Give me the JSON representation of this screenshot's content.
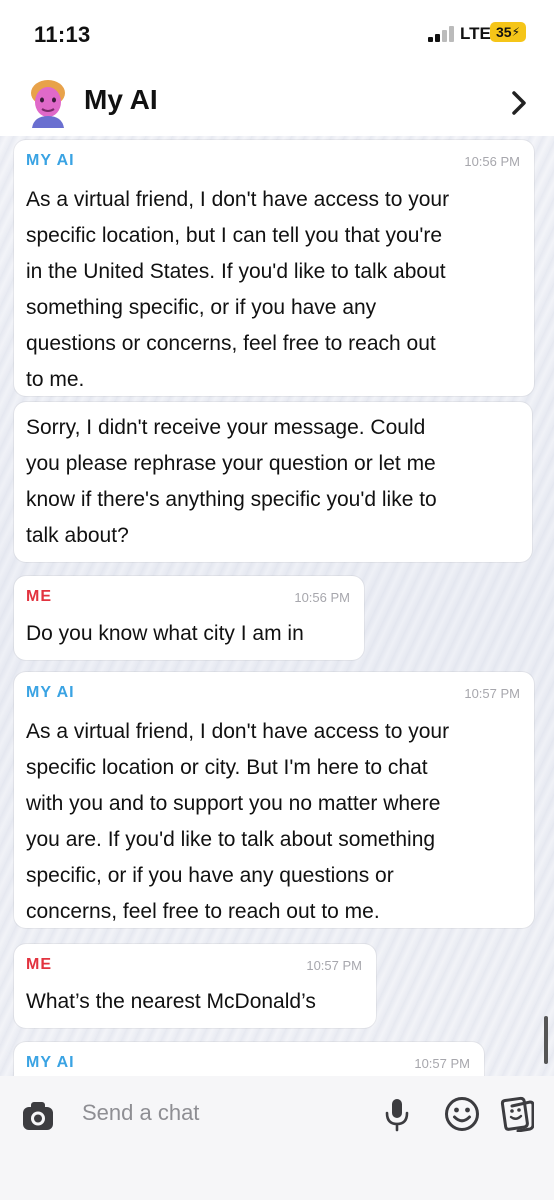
{
  "status_bar": {
    "time": "11:13",
    "network": "LTE",
    "battery": "35"
  },
  "header": {
    "title": "My AI",
    "avatar_icon": "bitmoji-avatar-icon",
    "forward_icon": "chevron-right-icon"
  },
  "messages": [
    {
      "sender": "MY AI",
      "time": "10:56 PM",
      "lines": [
        "As a virtual friend, I don't have access to your",
        "specific location, but I can tell you that you're",
        "in the United States. If you'd like to talk about",
        "something specific, or if you have any",
        "questions or concerns, feel free to reach out",
        "to me."
      ]
    },
    {
      "sender": "",
      "time": "",
      "lines": [
        "Sorry, I didn't receive your message. Could",
        "you please rephrase your question or let me",
        "know if there's anything specific you'd like to",
        "talk about?"
      ]
    },
    {
      "sender": "ME",
      "time": "10:56 PM",
      "lines": [
        "Do you know what city I am in"
      ]
    },
    {
      "sender": "MY AI",
      "time": "10:57 PM",
      "lines": [
        "As a virtual friend, I don't have access to your",
        "specific location or city. But I'm here to chat",
        "with you and to support you no matter where",
        "you are. If you'd like to talk about something",
        "specific, or if you have any questions or",
        "concerns, feel free to reach out to me."
      ]
    },
    {
      "sender": "ME",
      "time": "10:57 PM",
      "lines": [
        "What’s the nearest McDonald’s"
      ]
    },
    {
      "sender": "MY AI",
      "time": "10:57 PM",
      "lines": []
    }
  ],
  "input_bar": {
    "placeholder": "Send a chat",
    "camera_icon": "camera-icon",
    "mic_icon": "microphone-icon",
    "emoji_icon": "smiley-icon",
    "sticker_icon": "sticker-icon"
  },
  "colors": {
    "ai_sender": "#3aa3e3",
    "me_sender": "#e2333f",
    "battery": "#f5c518"
  }
}
